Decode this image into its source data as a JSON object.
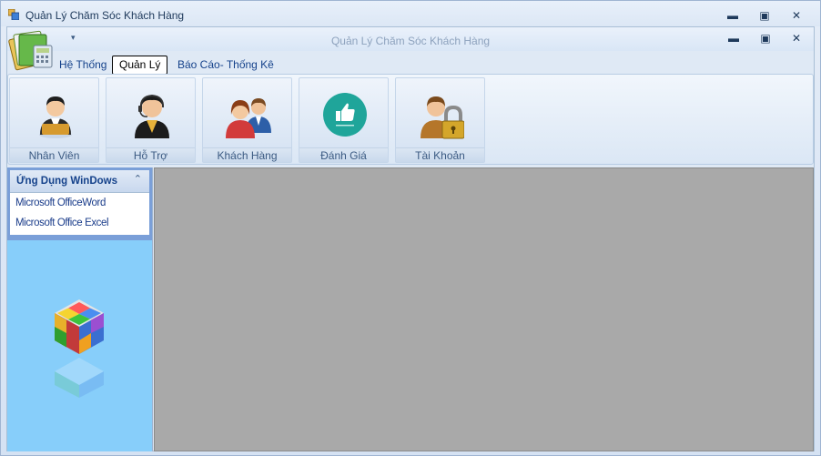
{
  "window": {
    "title": "Quản Lý Chăm Sóc Khách Hàng",
    "minimize_glyph": "▬",
    "maximize_glyph": "▣",
    "close_glyph": "✕"
  },
  "mdi": {
    "title": "Quản Lý Chăm Sóc Khách Hàng",
    "qat_glyph": "▾"
  },
  "menu": {
    "tabs": [
      {
        "label": "Hệ Thống",
        "active": false
      },
      {
        "label": "Quản Lý",
        "active": true
      },
      {
        "label": "Báo Cáo- Thống Kê",
        "active": false
      }
    ]
  },
  "ribbon": {
    "buttons": [
      {
        "label": "Nhân Viên",
        "icon": "employee-icon"
      },
      {
        "label": "Hỗ Trợ",
        "icon": "support-icon"
      },
      {
        "label": "Khách Hàng",
        "icon": "customers-icon"
      },
      {
        "label": "Đánh Giá",
        "icon": "rating-icon"
      },
      {
        "label": "Tài Khoản",
        "icon": "account-lock-icon"
      }
    ]
  },
  "nav": {
    "group_title": "Ứng Dụng WinDows",
    "collapse_glyph": "⌃",
    "items": [
      "Microsoft OfficeWord",
      "Microsoft Office Excel"
    ]
  },
  "colors": {
    "nav_background": "#87cefa",
    "workspace_background": "#a9a9a9",
    "accent": "#15428b"
  }
}
